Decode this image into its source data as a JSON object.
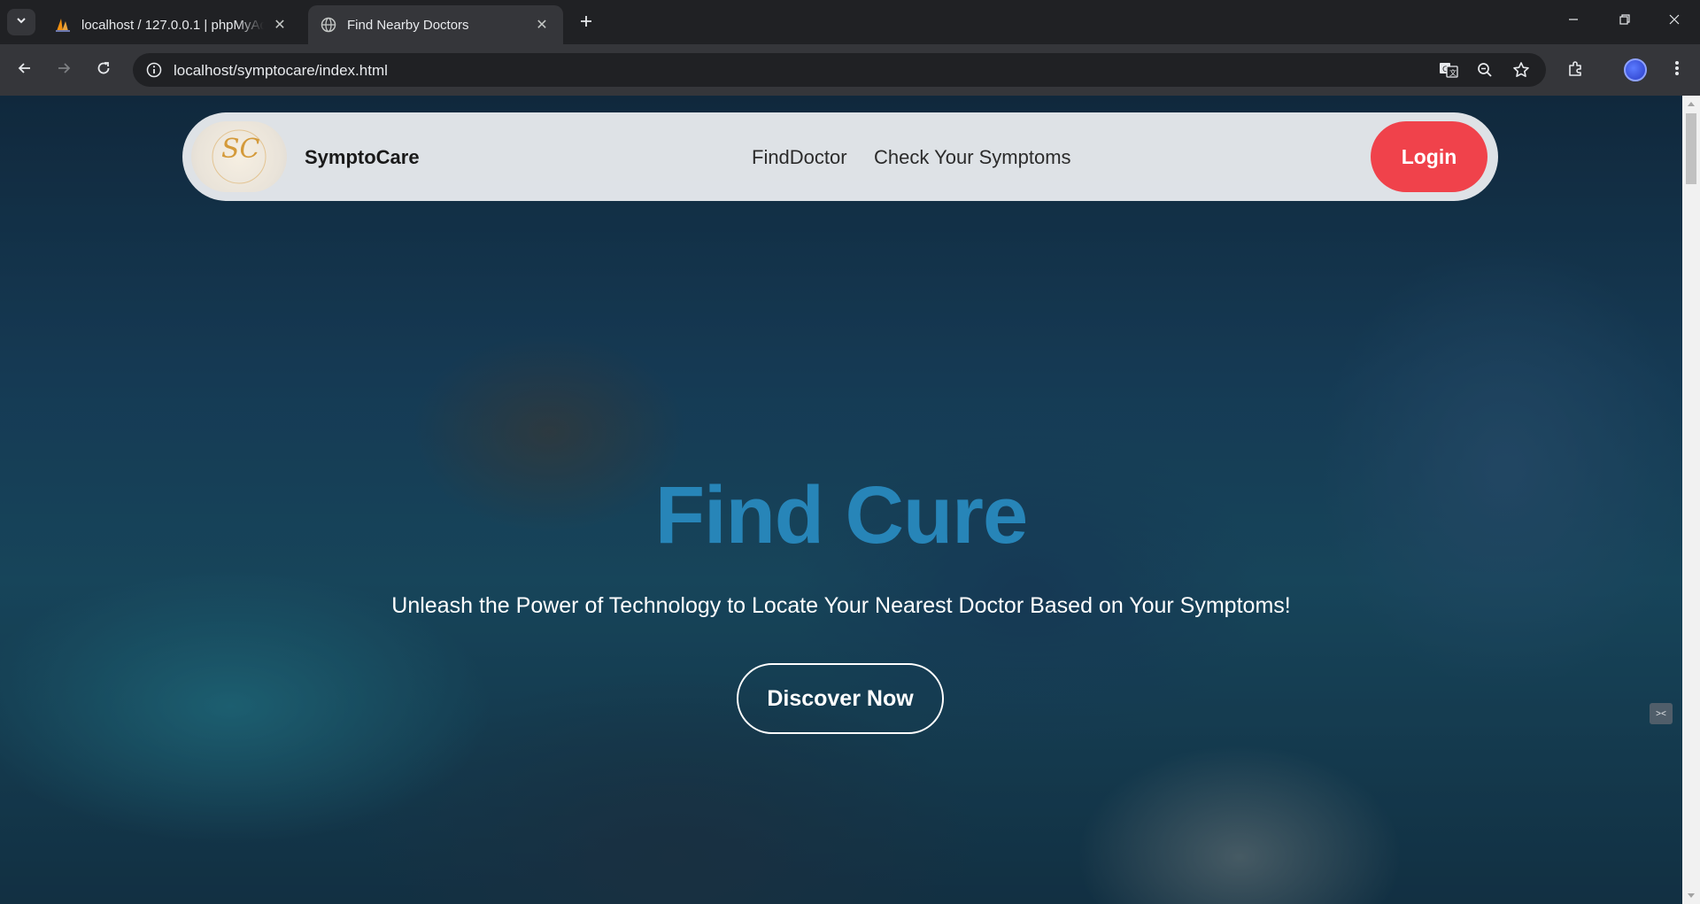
{
  "browser": {
    "tabs": [
      {
        "title": "localhost / 127.0.0.1 | phpMyAdmin",
        "favicon": "phpmyadmin-sail-icon",
        "active": false
      },
      {
        "title": "Find Nearby Doctors",
        "favicon": "globe-icon",
        "active": true
      }
    ],
    "url": "localhost/symptocare/index.html",
    "profile_initials": ""
  },
  "page": {
    "brand": "SymptoCare",
    "logo_text": "SC",
    "nav": {
      "find_doctor": "FindDoctor",
      "check_symptoms": "Check Your Symptoms",
      "login": "Login"
    },
    "hero": {
      "title": "Find Cure",
      "subtitle": "Unleash the Power of Technology to Locate Your Nearest Doctor Based on Your Symptoms!",
      "cta": "Discover Now"
    },
    "side_widget": "><"
  },
  "colors": {
    "accent_login": "#f0424b",
    "hero_title": "#2785b8",
    "chrome_dark": "#202124",
    "chrome_toolbar": "#35363a"
  }
}
